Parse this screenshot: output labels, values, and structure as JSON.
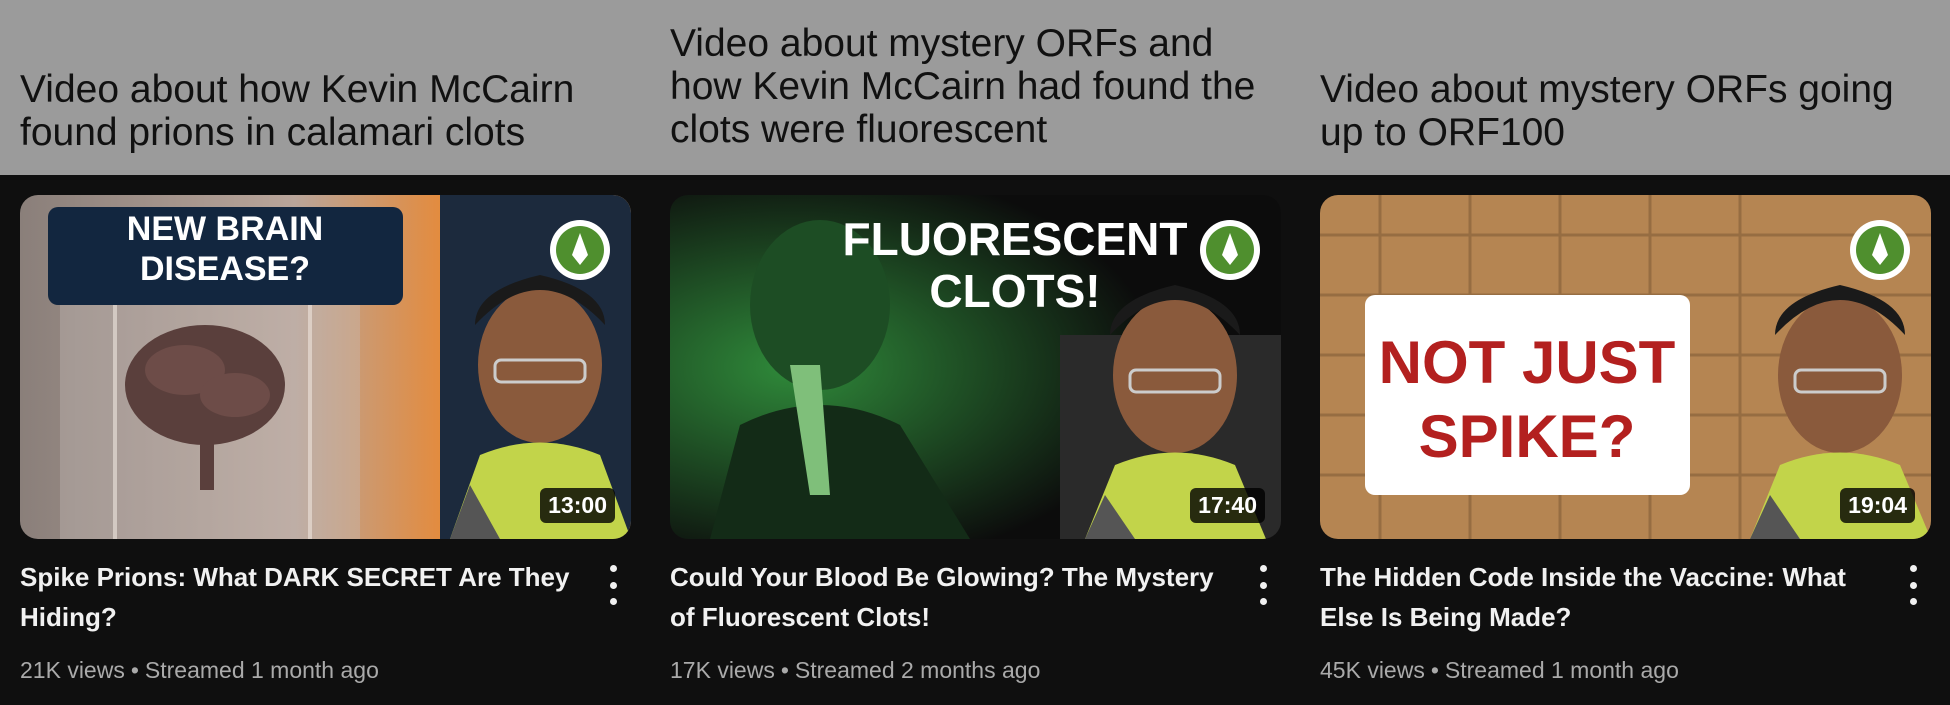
{
  "annotations": [
    "Video about how Kevin McCairn found prions in calamari clots",
    "Video about mystery ORFs and how Kevin McCairn had found the clots were fluorescent",
    "Video about mystery ORFs going up to ORF100"
  ],
  "videos": [
    {
      "thumb_text_line1": "NEW BRAIN",
      "thumb_text_line2": "DISEASE?",
      "duration": "13:00",
      "title": "Spike Prions: What DARK SECRET Are They Hiding?",
      "views": "21K views",
      "separator": "•",
      "age": "Streamed 1 month ago"
    },
    {
      "thumb_text_line1": "FLUORESCENT",
      "thumb_text_line2": "CLOTS!",
      "duration": "17:40",
      "title": "Could Your Blood Be Glowing? The Mystery of Fluorescent Clots!",
      "views": "17K views",
      "separator": "•",
      "age": "Streamed 2 months ago"
    },
    {
      "thumb_text_line1": "NOT JUST",
      "thumb_text_line2": "SPIKE?",
      "duration": "19:04",
      "title": "The Hidden Code Inside the Vaccine: What Else Is Being Made?",
      "views": "45K views",
      "separator": "•",
      "age": "Streamed 1 month ago"
    }
  ],
  "colors": {
    "annotation_background": "#9b9b9b",
    "page_background": "#0f0f0f",
    "title_text": "#f1f1f1",
    "meta_text": "#aaaaaa",
    "accent_red": "#b3201f",
    "accent_green": "#1f7a2e"
  },
  "icons": {
    "more": "vertical-ellipsis-icon",
    "channel_logo": "leaf-logo-icon"
  }
}
